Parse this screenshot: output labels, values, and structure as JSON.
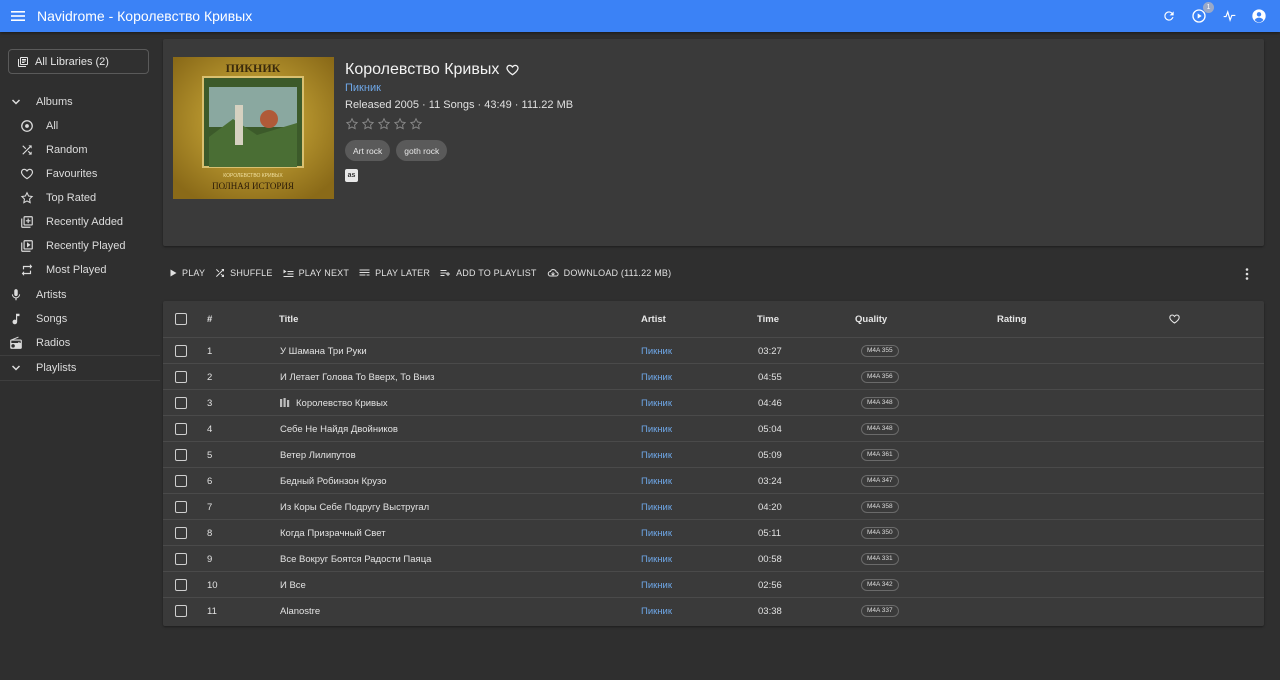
{
  "appbar": {
    "title": "Navidrome - Королевство Кривых",
    "activity_badge": "1"
  },
  "sidebar": {
    "library_selector": "All Libraries (2)",
    "albums_label": "Albums",
    "album_items": [
      {
        "label": "All",
        "icon": "album-icon"
      },
      {
        "label": "Random",
        "icon": "shuffle-icon"
      },
      {
        "label": "Favourites",
        "icon": "heart-icon"
      },
      {
        "label": "Top Rated",
        "icon": "star-icon"
      },
      {
        "label": "Recently Added",
        "icon": "library-add-icon"
      },
      {
        "label": "Recently Played",
        "icon": "video-library-icon"
      },
      {
        "label": "Most Played",
        "icon": "repeat-icon"
      }
    ],
    "artists_label": "Artists",
    "songs_label": "Songs",
    "radios_label": "Radios",
    "playlists_label": "Playlists"
  },
  "album": {
    "title": "Королевство Кривых",
    "artist": "Пикник",
    "meta": "Released 2005 · 11 Songs · 43:49 · 111.22 MB",
    "rating": 0,
    "genres": [
      "Art rock",
      "goth rock"
    ],
    "cover_text_top": "ПИКНИК",
    "cover_text_title": "КОРОЛЕВСТВО КРИВЫХ",
    "cover_text_bottom": "ПОЛНАЯ ИСТОРИЯ",
    "lastfm_label": "as"
  },
  "toolbar": {
    "play": "PLAY",
    "shuffle": "SHUFFLE",
    "play_next": "PLAY NEXT",
    "play_later": "PLAY LATER",
    "add_to_playlist": "ADD TO PLAYLIST",
    "download": "DOWNLOAD (111.22 MB)"
  },
  "table": {
    "headers": {
      "num": "#",
      "title": "Title",
      "artist": "Artist",
      "time": "Time",
      "quality": "Quality",
      "rating": "Rating"
    },
    "rows": [
      {
        "num": "1",
        "title": "У Шамана Три Руки",
        "artist": "Пикник",
        "time": "03:27",
        "quality": "M4A 355"
      },
      {
        "num": "2",
        "title": "И Летает Голова То Вверх, То Вниз",
        "artist": "Пикник",
        "time": "04:55",
        "quality": "M4A 356"
      },
      {
        "num": "3",
        "title": "Королевство Кривых",
        "artist": "Пикник",
        "time": "04:46",
        "quality": "M4A 348",
        "playing": true
      },
      {
        "num": "4",
        "title": "Себе Не Найдя Двойников",
        "artist": "Пикник",
        "time": "05:04",
        "quality": "M4A 348"
      },
      {
        "num": "5",
        "title": "Ветер Лилипутов",
        "artist": "Пикник",
        "time": "05:09",
        "quality": "M4A 361"
      },
      {
        "num": "6",
        "title": "Бедный Робинзон Крузо",
        "artist": "Пикник",
        "time": "03:24",
        "quality": "M4A 347"
      },
      {
        "num": "7",
        "title": "Из Коры Себе Подругу Выстругал",
        "artist": "Пикник",
        "time": "04:20",
        "quality": "M4A 358"
      },
      {
        "num": "8",
        "title": "Когда Призрачный Свет",
        "artist": "Пикник",
        "time": "05:11",
        "quality": "M4A 350"
      },
      {
        "num": "9",
        "title": "Все Вокруг Боятся Радости Паяца",
        "artist": "Пикник",
        "time": "00:58",
        "quality": "M4A 331"
      },
      {
        "num": "10",
        "title": "И Все",
        "artist": "Пикник",
        "time": "02:56",
        "quality": "M4A 342"
      },
      {
        "num": "11",
        "title": "Alanostre",
        "artist": "Пикник",
        "time": "03:38",
        "quality": "M4A 337"
      }
    ]
  },
  "colors": {
    "appbar": "#3b82f6",
    "link": "#6ea7e8",
    "background": "#2f2f2f",
    "card": "#3a3a3a"
  }
}
